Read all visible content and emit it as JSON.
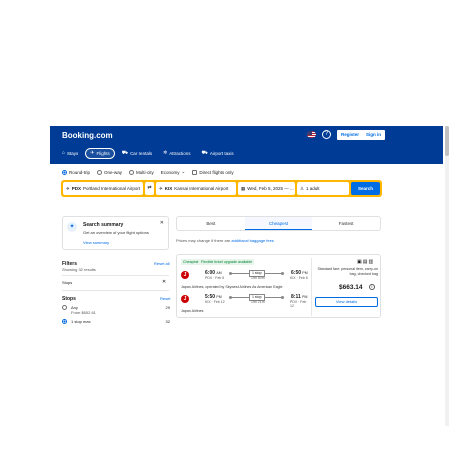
{
  "header": {
    "logo": "Booking.com",
    "help": "?",
    "register": "Register",
    "signin": "Sign in",
    "nav": [
      {
        "label": "Stays",
        "icon": "bed-icon",
        "glyph": "⌂"
      },
      {
        "label": "Flights",
        "icon": "plane-icon",
        "glyph": "✈"
      },
      {
        "label": "Car rentals",
        "icon": "car-icon",
        "glyph": "⛟"
      },
      {
        "label": "Attractions",
        "icon": "attractions-icon",
        "glyph": "✲"
      },
      {
        "label": "Airport taxis",
        "icon": "taxi-icon",
        "glyph": "⛟"
      }
    ]
  },
  "search": {
    "trip_types": [
      "Round-trip",
      "One-way",
      "Multi-city"
    ],
    "cabin": "Economy",
    "direct_only": "Direct flights only",
    "from_code": "PDX",
    "from_name": "Portland International Airport",
    "to_code": "KIX",
    "to_name": "Kansai International Airport",
    "dates": "Wed, Feb 5, 2025 — ...",
    "passengers": "1 adult",
    "button": "Search"
  },
  "summary": {
    "title": "Search summary",
    "text": "Get an overview of your flight options",
    "link": "View summary",
    "close": "✕"
  },
  "filters": {
    "title": "Filters",
    "showing": "Showing 32 results",
    "reset_all": "Reset all",
    "active_chip": "Stops",
    "chip_close": "✕",
    "stops_title": "Stops",
    "stops_reset": "Reset",
    "stop_options": [
      {
        "label": "Any",
        "sub": "From $652.61",
        "count": "29",
        "selected": false
      },
      {
        "label": "1 stop max",
        "sub": "",
        "count": "32",
        "selected": true
      }
    ]
  },
  "sort": {
    "tabs": [
      "Best",
      "Cheapest",
      "Fastest"
    ],
    "active": "Cheapest",
    "note": "Prices may change if there are",
    "note_link": "additional baggage fees"
  },
  "result": {
    "badge_cheapest": "Cheapest",
    "badge_flex": "Flexible ticket upgrade available",
    "outbound": {
      "dep_time": "6:00",
      "dep_ampm": "AM",
      "dep_meta": "PDX · Feb 5",
      "arr_time": "6:50",
      "arr_ampm": "PM",
      "arr_meta": "KIX · Feb 6",
      "stops": "1 stop",
      "duration": "19h 50m"
    },
    "operator": "Japan Airlines, operated by Skywest Airlines As American Eagle",
    "inbound": {
      "dep_time": "5:50",
      "dep_ampm": "PM",
      "dep_meta": "KIX · Feb 12",
      "arr_time": "8:11",
      "arr_ampm": "PM",
      "arr_meta": "PDX · Feb 12",
      "stops": "1 stop",
      "duration": "19h 21m"
    },
    "inbound_operator": "Japan Airlines",
    "bag_note": "Standard fare: personal item, carry-on bag, checked bag",
    "price": "$663.14",
    "view_details": "View details"
  },
  "colors": {
    "brand": "#003b95",
    "accent": "#006ce4",
    "search_border": "#ffb700"
  }
}
